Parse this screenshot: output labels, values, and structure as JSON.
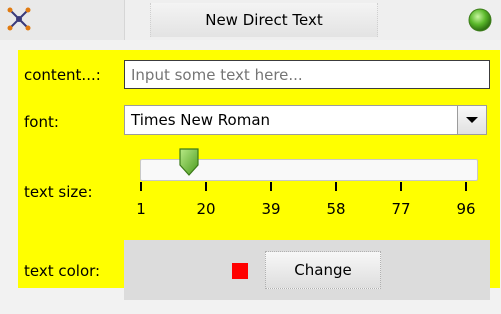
{
  "window": {
    "title": "New Direct Text",
    "left_icon": "move-icon",
    "right_icon": "status-indicator-icon"
  },
  "form": {
    "content_label": "content...:",
    "content_placeholder": "Input some text here...",
    "content_value": "",
    "font_label": "font:",
    "font_value": "Times New Roman",
    "font_dropdown_icon": "chevron-down-icon",
    "text_size_label": "text size:",
    "text_size": {
      "min": 1,
      "max": 96,
      "value": 15,
      "tick_labels": [
        "1",
        "20",
        "39",
        "58",
        "77",
        "96"
      ]
    },
    "text_color_label": "text color:",
    "text_color": "#ff0000",
    "change_button": "Change"
  },
  "colors": {
    "panel_background": "#ffff00",
    "accent_green": "#5ab82a"
  }
}
